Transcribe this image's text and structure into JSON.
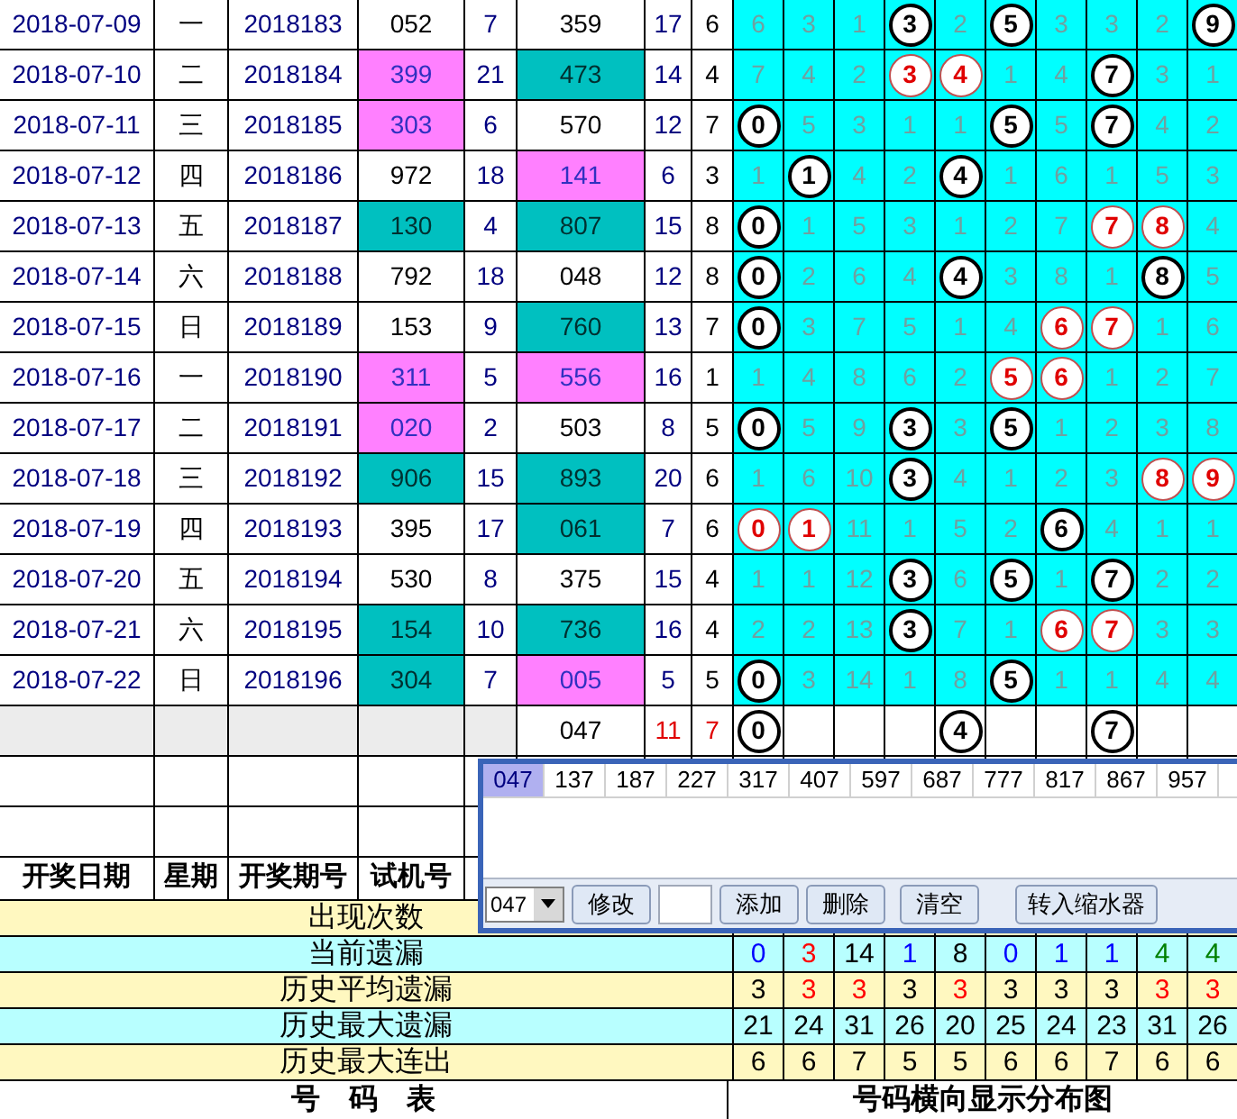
{
  "rows": [
    {
      "date": "2018-07-09",
      "weekday": "一",
      "issue": "2018183",
      "trial": {
        "text": "052",
        "color": "#ffffff"
      },
      "column_5": "7",
      "number": {
        "text": "359",
        "color": "#ffffff"
      },
      "column_7": "17",
      "column_8": "6",
      "cells": [
        {
          "text": "6",
          "kind": "miss"
        },
        {
          "text": "3",
          "kind": "miss"
        },
        {
          "text": "1",
          "kind": "miss"
        },
        {
          "text": "3",
          "kind": "ball"
        },
        {
          "text": "2",
          "kind": "miss"
        },
        {
          "text": "5",
          "kind": "ball"
        },
        {
          "text": "3",
          "kind": "miss"
        },
        {
          "text": "3",
          "kind": "miss"
        },
        {
          "text": "2",
          "kind": "miss"
        },
        {
          "text": "9",
          "kind": "ball"
        }
      ]
    },
    {
      "date": "2018-07-10",
      "weekday": "二",
      "issue": "2018184",
      "trial": {
        "text": "399",
        "color": "#ff80ff"
      },
      "column_5": "21",
      "number": {
        "text": "473",
        "color": "#00c0c0"
      },
      "column_7": "14",
      "column_8": "4",
      "cells": [
        {
          "text": "7",
          "kind": "miss"
        },
        {
          "text": "4",
          "kind": "miss"
        },
        {
          "text": "2",
          "kind": "miss"
        },
        {
          "text": "3",
          "kind": "ball_red"
        },
        {
          "text": "4",
          "kind": "ball_red"
        },
        {
          "text": "1",
          "kind": "miss"
        },
        {
          "text": "4",
          "kind": "miss"
        },
        {
          "text": "7",
          "kind": "ball"
        },
        {
          "text": "3",
          "kind": "miss"
        },
        {
          "text": "1",
          "kind": "miss"
        }
      ]
    },
    {
      "date": "2018-07-11",
      "weekday": "三",
      "issue": "2018185",
      "trial": {
        "text": "303",
        "color": "#ff80ff"
      },
      "column_5": "6",
      "number": {
        "text": "570",
        "color": "#ffffff"
      },
      "column_7": "12",
      "column_8": "7",
      "cells": [
        {
          "text": "0",
          "kind": "ball"
        },
        {
          "text": "5",
          "kind": "miss"
        },
        {
          "text": "3",
          "kind": "miss"
        },
        {
          "text": "1",
          "kind": "miss"
        },
        {
          "text": "1",
          "kind": "miss"
        },
        {
          "text": "5",
          "kind": "ball"
        },
        {
          "text": "5",
          "kind": "miss"
        },
        {
          "text": "7",
          "kind": "ball"
        },
        {
          "text": "4",
          "kind": "miss"
        },
        {
          "text": "2",
          "kind": "miss"
        }
      ]
    },
    {
      "date": "2018-07-12",
      "weekday": "四",
      "issue": "2018186",
      "trial": {
        "text": "972",
        "color": "#ffffff"
      },
      "column_5": "18",
      "number": {
        "text": "141",
        "color": "#ff80ff"
      },
      "column_7": "6",
      "column_8": "3",
      "cells": [
        {
          "text": "1",
          "kind": "miss"
        },
        {
          "text": "1",
          "kind": "ball"
        },
        {
          "text": "4",
          "kind": "miss"
        },
        {
          "text": "2",
          "kind": "miss"
        },
        {
          "text": "4",
          "kind": "ball"
        },
        {
          "text": "1",
          "kind": "miss"
        },
        {
          "text": "6",
          "kind": "miss"
        },
        {
          "text": "1",
          "kind": "miss"
        },
        {
          "text": "5",
          "kind": "miss"
        },
        {
          "text": "3",
          "kind": "miss"
        }
      ]
    },
    {
      "date": "2018-07-13",
      "weekday": "五",
      "issue": "2018187",
      "trial": {
        "text": "130",
        "color": "#00c0c0"
      },
      "column_5": "4",
      "number": {
        "text": "807",
        "color": "#00c0c0"
      },
      "column_7": "15",
      "column_8": "8",
      "cells": [
        {
          "text": "0",
          "kind": "ball"
        },
        {
          "text": "1",
          "kind": "miss"
        },
        {
          "text": "5",
          "kind": "miss"
        },
        {
          "text": "3",
          "kind": "miss"
        },
        {
          "text": "1",
          "kind": "miss"
        },
        {
          "text": "2",
          "kind": "miss"
        },
        {
          "text": "7",
          "kind": "miss"
        },
        {
          "text": "7",
          "kind": "ball_red"
        },
        {
          "text": "8",
          "kind": "ball_red"
        },
        {
          "text": "4",
          "kind": "miss"
        }
      ]
    },
    {
      "date": "2018-07-14",
      "weekday": "六",
      "issue": "2018188",
      "trial": {
        "text": "792",
        "color": "#ffffff"
      },
      "column_5": "18",
      "number": {
        "text": "048",
        "color": "#ffffff"
      },
      "column_7": "12",
      "column_8": "8",
      "cells": [
        {
          "text": "0",
          "kind": "ball"
        },
        {
          "text": "2",
          "kind": "miss"
        },
        {
          "text": "6",
          "kind": "miss"
        },
        {
          "text": "4",
          "kind": "miss"
        },
        {
          "text": "4",
          "kind": "ball"
        },
        {
          "text": "3",
          "kind": "miss"
        },
        {
          "text": "8",
          "kind": "miss"
        },
        {
          "text": "1",
          "kind": "miss"
        },
        {
          "text": "8",
          "kind": "ball"
        },
        {
          "text": "5",
          "kind": "miss"
        }
      ]
    },
    {
      "date": "2018-07-15",
      "weekday": "日",
      "issue": "2018189",
      "trial": {
        "text": "153",
        "color": "#ffffff"
      },
      "column_5": "9",
      "number": {
        "text": "760",
        "color": "#00c0c0"
      },
      "column_7": "13",
      "column_8": "7",
      "cells": [
        {
          "text": "0",
          "kind": "ball"
        },
        {
          "text": "3",
          "kind": "miss"
        },
        {
          "text": "7",
          "kind": "miss"
        },
        {
          "text": "5",
          "kind": "miss"
        },
        {
          "text": "1",
          "kind": "miss"
        },
        {
          "text": "4",
          "kind": "miss"
        },
        {
          "text": "6",
          "kind": "ball_red"
        },
        {
          "text": "7",
          "kind": "ball_red"
        },
        {
          "text": "1",
          "kind": "miss"
        },
        {
          "text": "6",
          "kind": "miss"
        }
      ]
    },
    {
      "date": "2018-07-16",
      "weekday": "一",
      "issue": "2018190",
      "trial": {
        "text": "311",
        "color": "#ff80ff"
      },
      "column_5": "5",
      "number": {
        "text": "556",
        "color": "#ff80ff"
      },
      "column_7": "16",
      "column_8": "1",
      "cells": [
        {
          "text": "1",
          "kind": "miss"
        },
        {
          "text": "4",
          "kind": "miss"
        },
        {
          "text": "8",
          "kind": "miss"
        },
        {
          "text": "6",
          "kind": "miss"
        },
        {
          "text": "2",
          "kind": "miss"
        },
        {
          "text": "5",
          "kind": "ball_red"
        },
        {
          "text": "6",
          "kind": "ball_red"
        },
        {
          "text": "1",
          "kind": "miss"
        },
        {
          "text": "2",
          "kind": "miss"
        },
        {
          "text": "7",
          "kind": "miss"
        }
      ]
    },
    {
      "date": "2018-07-17",
      "weekday": "二",
      "issue": "2018191",
      "trial": {
        "text": "020",
        "color": "#ff80ff"
      },
      "column_5": "2",
      "number": {
        "text": "503",
        "color": "#ffffff"
      },
      "column_7": "8",
      "column_8": "5",
      "cells": [
        {
          "text": "0",
          "kind": "ball"
        },
        {
          "text": "5",
          "kind": "miss"
        },
        {
          "text": "9",
          "kind": "miss"
        },
        {
          "text": "3",
          "kind": "ball"
        },
        {
          "text": "3",
          "kind": "miss"
        },
        {
          "text": "5",
          "kind": "ball"
        },
        {
          "text": "1",
          "kind": "miss"
        },
        {
          "text": "2",
          "kind": "miss"
        },
        {
          "text": "3",
          "kind": "miss"
        },
        {
          "text": "8",
          "kind": "miss"
        }
      ]
    },
    {
      "date": "2018-07-18",
      "weekday": "三",
      "issue": "2018192",
      "trial": {
        "text": "906",
        "color": "#00c0c0"
      },
      "column_5": "15",
      "number": {
        "text": "893",
        "color": "#00c0c0"
      },
      "column_7": "20",
      "column_8": "6",
      "cells": [
        {
          "text": "1",
          "kind": "miss"
        },
        {
          "text": "6",
          "kind": "miss"
        },
        {
          "text": "10",
          "kind": "miss"
        },
        {
          "text": "3",
          "kind": "ball"
        },
        {
          "text": "4",
          "kind": "miss"
        },
        {
          "text": "1",
          "kind": "miss"
        },
        {
          "text": "2",
          "kind": "miss"
        },
        {
          "text": "3",
          "kind": "miss"
        },
        {
          "text": "8",
          "kind": "ball_red"
        },
        {
          "text": "9",
          "kind": "ball_red"
        }
      ]
    },
    {
      "date": "2018-07-19",
      "weekday": "四",
      "issue": "2018193",
      "trial": {
        "text": "395",
        "color": "#ffffff"
      },
      "column_5": "17",
      "number": {
        "text": "061",
        "color": "#00c0c0"
      },
      "column_7": "7",
      "column_8": "6",
      "cells": [
        {
          "text": "0",
          "kind": "ball_red"
        },
        {
          "text": "1",
          "kind": "ball_red"
        },
        {
          "text": "11",
          "kind": "miss"
        },
        {
          "text": "1",
          "kind": "miss"
        },
        {
          "text": "5",
          "kind": "miss"
        },
        {
          "text": "2",
          "kind": "miss"
        },
        {
          "text": "6",
          "kind": "ball"
        },
        {
          "text": "4",
          "kind": "miss"
        },
        {
          "text": "1",
          "kind": "miss"
        },
        {
          "text": "1",
          "kind": "miss"
        }
      ]
    },
    {
      "date": "2018-07-20",
      "weekday": "五",
      "issue": "2018194",
      "trial": {
        "text": "530",
        "color": "#ffffff"
      },
      "column_5": "8",
      "number": {
        "text": "375",
        "color": "#ffffff"
      },
      "column_7": "15",
      "column_8": "4",
      "cells": [
        {
          "text": "1",
          "kind": "miss"
        },
        {
          "text": "1",
          "kind": "miss"
        },
        {
          "text": "12",
          "kind": "miss"
        },
        {
          "text": "3",
          "kind": "ball"
        },
        {
          "text": "6",
          "kind": "miss"
        },
        {
          "text": "5",
          "kind": "ball"
        },
        {
          "text": "1",
          "kind": "miss"
        },
        {
          "text": "7",
          "kind": "ball"
        },
        {
          "text": "2",
          "kind": "miss"
        },
        {
          "text": "2",
          "kind": "miss"
        }
      ]
    },
    {
      "date": "2018-07-21",
      "weekday": "六",
      "issue": "2018195",
      "trial": {
        "text": "154",
        "color": "#00c0c0"
      },
      "column_5": "10",
      "number": {
        "text": "736",
        "color": "#00c0c0"
      },
      "column_7": "16",
      "column_8": "4",
      "cells": [
        {
          "text": "2",
          "kind": "miss"
        },
        {
          "text": "2",
          "kind": "miss"
        },
        {
          "text": "13",
          "kind": "miss"
        },
        {
          "text": "3",
          "kind": "ball"
        },
        {
          "text": "7",
          "kind": "miss"
        },
        {
          "text": "1",
          "kind": "miss"
        },
        {
          "text": "6",
          "kind": "ball_red"
        },
        {
          "text": "7",
          "kind": "ball_red"
        },
        {
          "text": "3",
          "kind": "miss"
        },
        {
          "text": "3",
          "kind": "miss"
        }
      ]
    },
    {
      "date": "2018-07-22",
      "weekday": "日",
      "issue": "2018196",
      "trial": {
        "text": "304",
        "color": "#00c0c0"
      },
      "column_5": "7",
      "number": {
        "text": "005",
        "color": "#ff80ff"
      },
      "column_7": "5",
      "column_8": "5",
      "cells": [
        {
          "text": "0",
          "kind": "ball"
        },
        {
          "text": "3",
          "kind": "miss"
        },
        {
          "text": "14",
          "kind": "miss"
        },
        {
          "text": "1",
          "kind": "miss"
        },
        {
          "text": "8",
          "kind": "miss"
        },
        {
          "text": "5",
          "kind": "ball"
        },
        {
          "text": "1",
          "kind": "miss"
        },
        {
          "text": "1",
          "kind": "miss"
        },
        {
          "text": "4",
          "kind": "miss"
        },
        {
          "text": "4",
          "kind": "miss"
        }
      ]
    }
  ],
  "total_row": {
    "number": "047",
    "column_7": "11",
    "column_8": "7",
    "cells": [
      {
        "text": "0",
        "kind": "ball"
      },
      {
        "kind": "empty"
      },
      {
        "kind": "empty"
      },
      {
        "kind": "empty"
      },
      {
        "text": "4",
        "kind": "ball"
      },
      {
        "kind": "empty"
      },
      {
        "kind": "empty"
      },
      {
        "text": "7",
        "kind": "ball"
      },
      {
        "kind": "empty"
      },
      {
        "kind": "empty"
      }
    ]
  },
  "header": [
    "开奖日期",
    "星期",
    "开奖期号",
    "试机号"
  ],
  "stats": [
    {
      "label": "出现次数",
      "color": "#fff8c0"
    },
    {
      "label": "当前遗漏",
      "color": "#b8ffff",
      "values": [
        {
          "text": "0",
          "color": "#0000ff"
        },
        {
          "text": "3",
          "color": "#ff0000"
        },
        {
          "text": "14",
          "color": "#000000"
        },
        {
          "text": "1",
          "color": "#0000ff"
        },
        {
          "text": "8",
          "color": "#000000"
        },
        {
          "text": "0",
          "color": "#0000ff"
        },
        {
          "text": "1",
          "color": "#0000ff"
        },
        {
          "text": "1",
          "color": "#0000ff"
        },
        {
          "text": "4",
          "color": "#008000"
        },
        {
          "text": "4",
          "color": "#008000"
        }
      ]
    },
    {
      "label": "历史平均遗漏",
      "color": "#fff8c0",
      "values": [
        {
          "text": "3",
          "color": "#000000"
        },
        {
          "text": "3",
          "color": "#ff0000"
        },
        {
          "text": "3",
          "color": "#ff0000"
        },
        {
          "text": "3",
          "color": "#000000"
        },
        {
          "text": "3",
          "color": "#ff0000"
        },
        {
          "text": "3",
          "color": "#000000"
        },
        {
          "text": "3",
          "color": "#000000"
        },
        {
          "text": "3",
          "color": "#000000"
        },
        {
          "text": "3",
          "color": "#ff0000"
        },
        {
          "text": "3",
          "color": "#ff0000"
        }
      ]
    },
    {
      "label": "历史最大遗漏",
      "color": "#b8ffff",
      "values": [
        {
          "text": "21",
          "color": "#000000"
        },
        {
          "text": "24",
          "color": "#000000"
        },
        {
          "text": "31",
          "color": "#000000"
        },
        {
          "text": "26",
          "color": "#000000"
        },
        {
          "text": "20",
          "color": "#000000"
        },
        {
          "text": "25",
          "color": "#000000"
        },
        {
          "text": "24",
          "color": "#000000"
        },
        {
          "text": "23",
          "color": "#000000"
        },
        {
          "text": "31",
          "color": "#000000"
        },
        {
          "text": "26",
          "color": "#000000"
        }
      ]
    },
    {
      "label": "历史最大连出",
      "color": "#fff8c0",
      "values": [
        {
          "text": "6",
          "color": "#000000"
        },
        {
          "text": "6",
          "color": "#000000"
        },
        {
          "text": "7",
          "color": "#000000"
        },
        {
          "text": "5",
          "color": "#000000"
        },
        {
          "text": "5",
          "color": "#000000"
        },
        {
          "text": "6",
          "color": "#000000"
        },
        {
          "text": "6",
          "color": "#000000"
        },
        {
          "text": "7",
          "color": "#000000"
        },
        {
          "text": "6",
          "color": "#000000"
        },
        {
          "text": "6",
          "color": "#000000"
        }
      ]
    }
  ],
  "footer": {
    "left": "号　码　表",
    "right": "号码横向显示分布图"
  },
  "dialog": {
    "numbers": [
      {
        "text": "047",
        "selected": true
      },
      {
        "text": "137",
        "selected": false
      },
      {
        "text": "187",
        "selected": false
      },
      {
        "text": "227",
        "selected": false
      },
      {
        "text": "317",
        "selected": false
      },
      {
        "text": "407",
        "selected": false
      },
      {
        "text": "597",
        "selected": false
      },
      {
        "text": "687",
        "selected": false
      },
      {
        "text": "777",
        "selected": false
      },
      {
        "text": "817",
        "selected": false
      },
      {
        "text": "867",
        "selected": false
      },
      {
        "text": "957",
        "selected": false
      }
    ],
    "select_value": "047",
    "buttons": [
      "修改",
      "添加",
      "删除",
      "清空"
    ],
    "transfer_button": "转入缩水器"
  }
}
